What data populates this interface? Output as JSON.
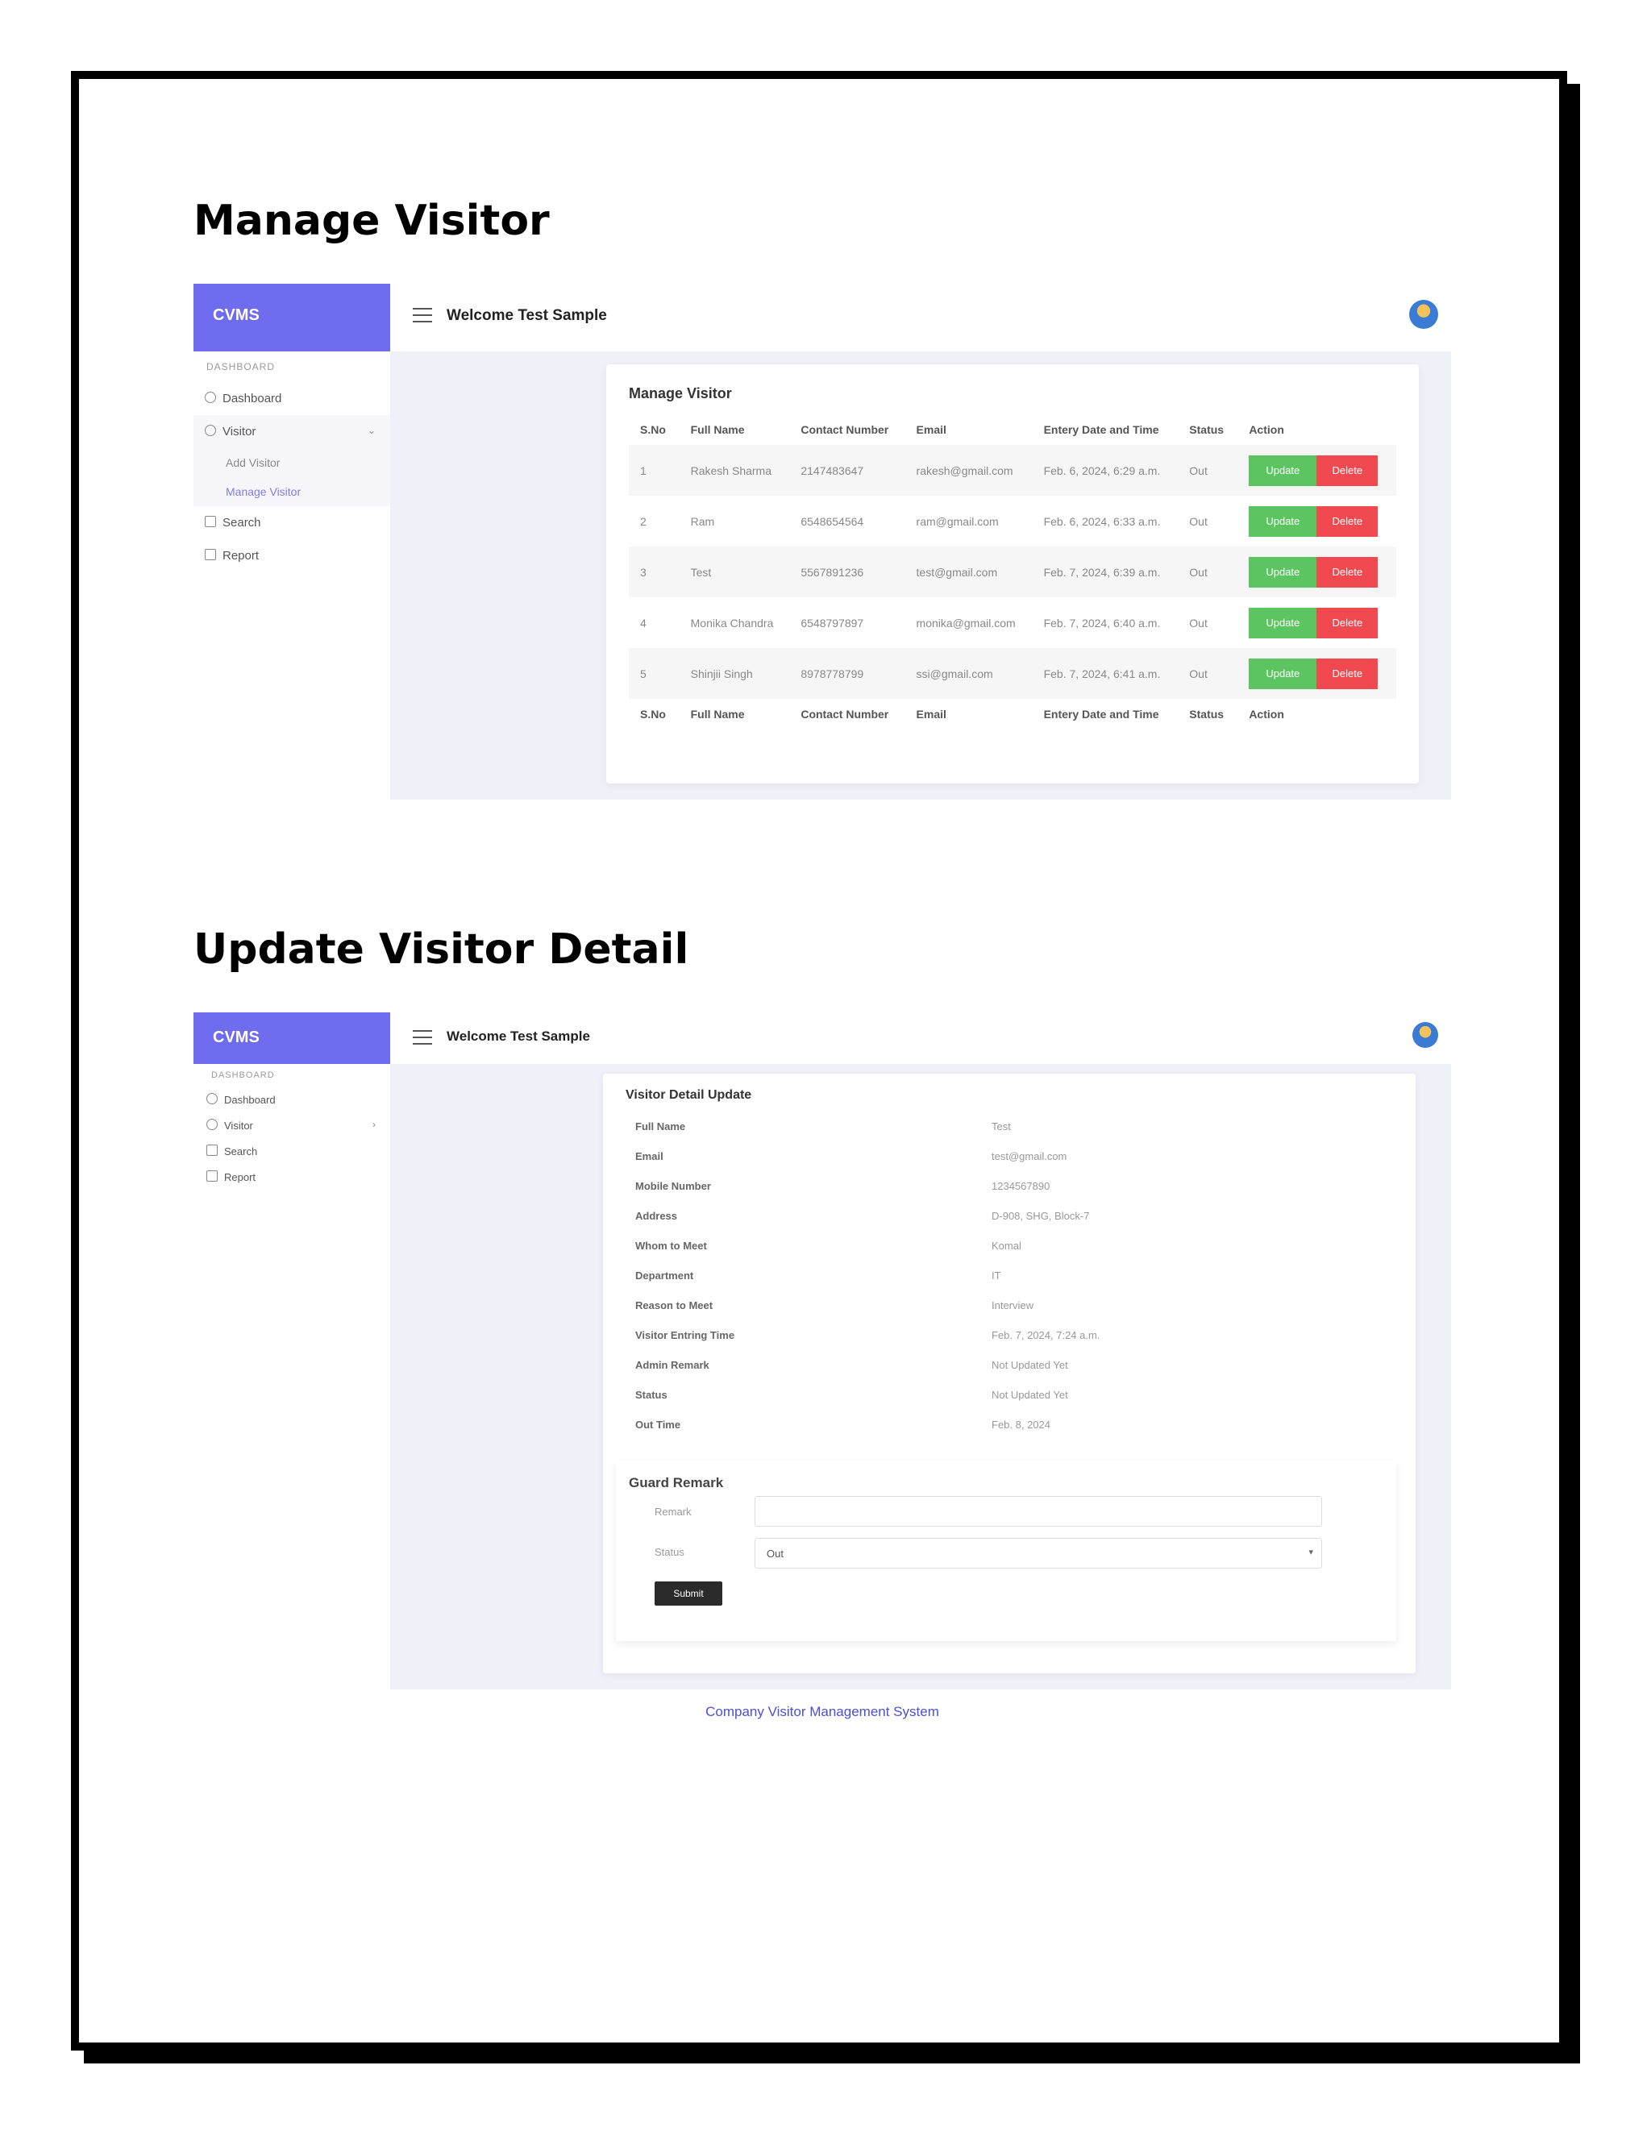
{
  "sections": {
    "manage_heading": "Manage Visitor",
    "update_heading": "Update Visitor Detail"
  },
  "app": {
    "brand": "CVMS",
    "welcome": "Welcome Test Sample"
  },
  "sidebar": {
    "header": "DASHBOARD",
    "dashboard": "Dashboard",
    "visitor": "Visitor",
    "add_visitor": "Add Visitor",
    "manage_visitor": "Manage Visitor",
    "search": "Search",
    "report": "Report"
  },
  "manage": {
    "title": "Manage Visitor",
    "columns": [
      "S.No",
      "Full Name",
      "Contact Number",
      "Email",
      "Entery Date and Time",
      "Status",
      "Action"
    ],
    "rows": [
      {
        "sno": "1",
        "name": "Rakesh Sharma",
        "contact": "2147483647",
        "email": "rakesh@gmail.com",
        "date": "Feb. 6, 2024, 6:29 a.m.",
        "status": "Out"
      },
      {
        "sno": "2",
        "name": "Ram",
        "contact": "6548654564",
        "email": "ram@gmail.com",
        "date": "Feb. 6, 2024, 6:33 a.m.",
        "status": "Out"
      },
      {
        "sno": "3",
        "name": "Test",
        "contact": "5567891236",
        "email": "test@gmail.com",
        "date": "Feb. 7, 2024, 6:39 a.m.",
        "status": "Out"
      },
      {
        "sno": "4",
        "name": "Monika Chandra",
        "contact": "6548797897",
        "email": "monika@gmail.com",
        "date": "Feb. 7, 2024, 6:40 a.m.",
        "status": "Out"
      },
      {
        "sno": "5",
        "name": "Shinjii Singh",
        "contact": "8978778799",
        "email": "ssi@gmail.com",
        "date": "Feb. 7, 2024, 6:41 a.m.",
        "status": "Out"
      }
    ],
    "update_label": "Update",
    "delete_label": "Delete"
  },
  "detail": {
    "title": "Visitor Detail Update",
    "fields": [
      {
        "label": "Full Name",
        "value": "Test"
      },
      {
        "label": "Email",
        "value": "test@gmail.com"
      },
      {
        "label": "Mobile Number",
        "value": "1234567890"
      },
      {
        "label": "Address",
        "value": "D-908, SHG, Block-7"
      },
      {
        "label": "Whom to Meet",
        "value": "Komal"
      },
      {
        "label": "Department",
        "value": "IT"
      },
      {
        "label": "Reason to Meet",
        "value": "Interview"
      },
      {
        "label": "Visitor Entring Time",
        "value": "Feb. 7, 2024, 7:24 a.m."
      },
      {
        "label": "Admin Remark",
        "value": "Not Updated Yet"
      },
      {
        "label": "Status",
        "value": "Not Updated Yet"
      },
      {
        "label": "Out Time",
        "value": "Feb. 8, 2024"
      }
    ],
    "guard_title": "Guard Remark",
    "remark_label": "Remark",
    "remark_value": "",
    "status_label": "Status",
    "status_value": "Out",
    "submit_label": "Submit"
  },
  "footer": "Company Visitor Management System",
  "colors": {
    "brand": "#6f6cf0",
    "update": "#5cc561",
    "delete": "#f04a50",
    "footer_link": "#4b4fd6"
  },
  "icons": [
    "menu-icon",
    "avatar-icon",
    "dashboard-icon",
    "visitor-icon",
    "search-icon",
    "report-icon",
    "chevron-down-icon",
    "chevron-right-icon"
  ]
}
